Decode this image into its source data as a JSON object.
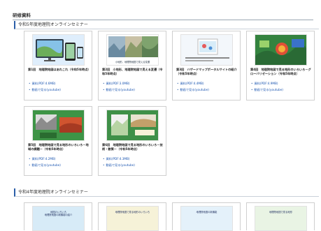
{
  "header": {
    "title": "研修資料"
  },
  "sections": [
    {
      "title": "令和5年度地理院オンラインセミナー"
    },
    {
      "title": "令和4年度地理院オンラインセミナー"
    }
  ],
  "cards": [
    {
      "title": "第1回　地理院地図はあれこれ（令和5年時点）",
      "material": "資料(PDF:4.6MB)",
      "video": "動画で見る(youtube)"
    },
    {
      "title": "第2回　小地形、地理院地図で見える変遷（令和5年時点）",
      "material": "資料(PDF:3.0MB)",
      "video": "動画で見る(youtube)",
      "thumb_caption": "小地形、地理院地図で見える変遷"
    },
    {
      "title": "第3回　ハザードマップポータルサイトの紹介（令和5年時点）",
      "material": "資料(PDF:4.4MB)",
      "video": "動画で見る(youtube)"
    },
    {
      "title": "第4回　地理院地図で見る地形のいろいろ－グローバリゼーション（令和5年時点）",
      "material": "資料(PDF:4.9MB)",
      "video": "動画で見る(youtube)"
    },
    {
      "title": "第5回　地理院地図で見る地形のいろいろ－地域の課題－（令和5年時点）",
      "material": "資料(PDF:4.2MB)",
      "video": "動画で見る(youtube)"
    },
    {
      "title": "第6回　地理院地図で見る地形のいろいろ－技術・散策－（令和5年時点）",
      "material": "資料(PDF:4.3MB)",
      "video": "動画で見る(youtube)"
    }
  ],
  "preview_cards": [
    {
      "banner": "地図のいろいろ\n地理院地図の新機能の紹介"
    },
    {
      "banner": "地理院地図で見る地形のいろいろ"
    },
    {
      "banner": "地理院地図の新機能"
    },
    {
      "banner": "地理院地図で見る地形"
    }
  ],
  "colors": {
    "link": "#1a55b0",
    "accent": "#2a5ea8"
  }
}
